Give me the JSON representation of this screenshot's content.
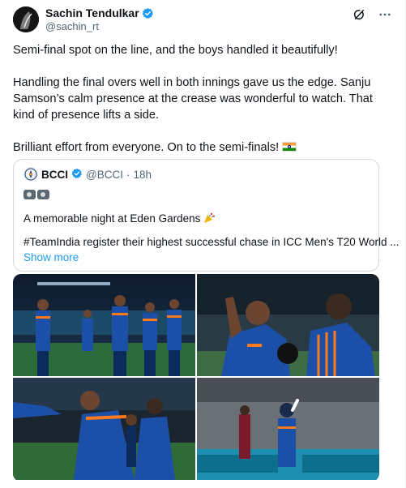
{
  "author": {
    "name": "Sachin Tendulkar",
    "handle": "@sachin_rt",
    "verified_color": "#1d9bf0"
  },
  "header_icons": [
    "grok-icon",
    "more-icon"
  ],
  "tweet": {
    "paragraphs": [
      "Semi-final spot on the line, and the boys handled it beautifully!",
      "Handling the final overs well in both innings gave us the edge. Sanju Samson’s calm presence at the crease was wonderful to watch. That kind of presence lifts a side.",
      "Brilliant effort from everyone. On to the semi-finals!"
    ],
    "flag_emoji": "indian-flag"
  },
  "quote": {
    "name": "BCCI",
    "handle": "@BCCI",
    "separator": "·",
    "time": "18h",
    "emoji_line": "camera-icons",
    "line1": "A memorable night at Eden Gardens",
    "line2": "#TeamIndia register their highest successful chase in ICC Men's T20 World ...",
    "show_more": "Show more"
  },
  "photos": [
    {
      "name": "team-celebration-stadium-photo"
    },
    {
      "name": "players-embrace-photo"
    },
    {
      "name": "players-handshake-photo"
    },
    {
      "name": "batter-celebration-photo"
    }
  ],
  "colors": {
    "accent": "#1d9bf0",
    "text": "#0f1419",
    "muted": "#536471",
    "team_india_blue": "#1c4fa8",
    "team_orange": "#ff7a1a"
  }
}
